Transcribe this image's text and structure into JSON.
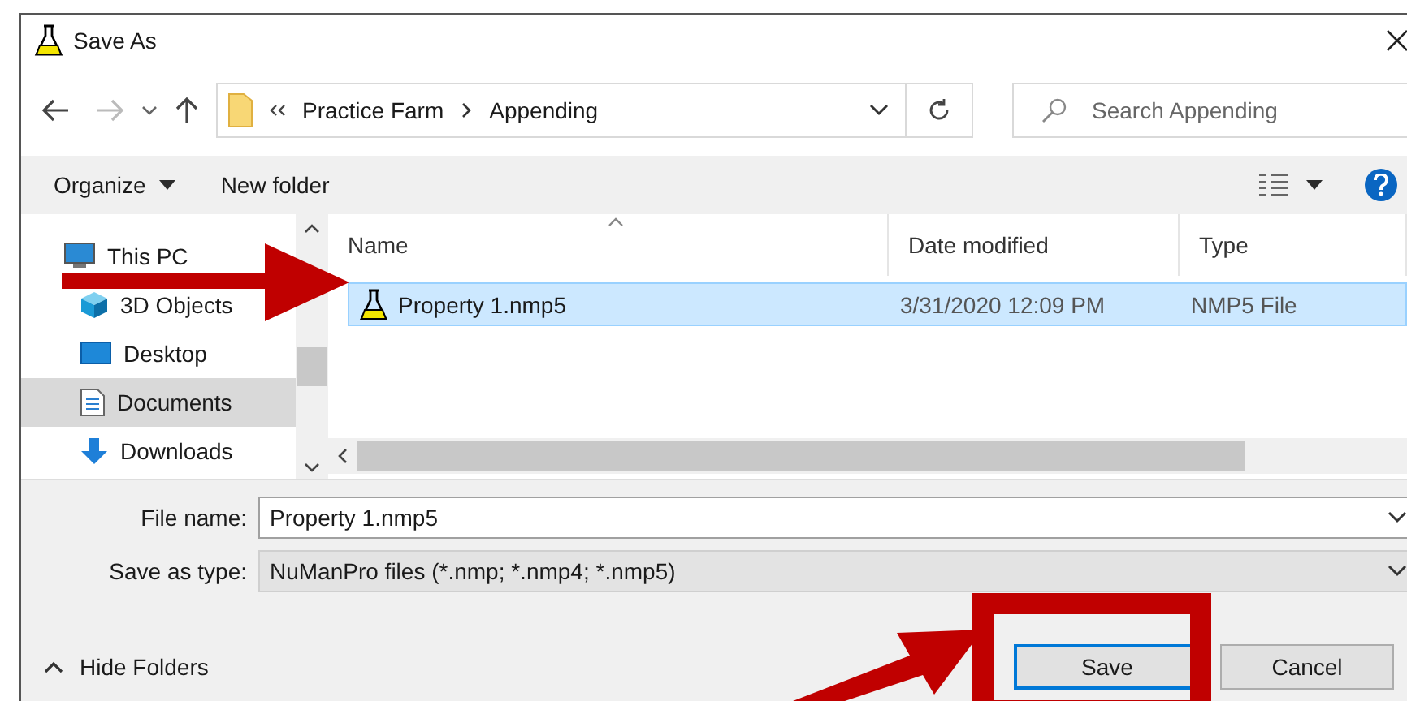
{
  "window": {
    "title": "Save As"
  },
  "address_bar": {
    "breadcrumbs": [
      "Practice Farm",
      "Appending"
    ]
  },
  "search": {
    "placeholder": "Search Appending"
  },
  "toolbar": {
    "buttons": [
      "Organize",
      "New folder"
    ]
  },
  "nav_pane": {
    "items": [
      {
        "label": "This PC",
        "kind": "pc",
        "selected": false,
        "children": [
          {
            "label": "3D Objects",
            "kind": "cube",
            "selected": false
          },
          {
            "label": "Desktop",
            "kind": "desktop",
            "selected": false
          },
          {
            "label": "Documents",
            "kind": "document",
            "selected": true
          },
          {
            "label": "Downloads",
            "kind": "download",
            "selected": false
          }
        ]
      }
    ]
  },
  "file_list": {
    "columns": [
      "Name",
      "Date modified",
      "Type"
    ],
    "rows": [
      {
        "name": "Property 1.nmp5",
        "date_modified": "3/31/2020 12:09 PM",
        "type": "NMP5 File",
        "selected": true
      }
    ]
  },
  "form": {
    "file_name": {
      "label": "File name:",
      "value": "Property 1.nmp5"
    },
    "save_as_type": {
      "label": "Save as type:",
      "value": "NuManPro files (*.nmp; *.nmp4; *.nmp5)"
    }
  },
  "footer": {
    "hide_folders": "Hide Folders",
    "buttons": [
      {
        "label": "Save",
        "kind": "default"
      },
      {
        "label": "Cancel",
        "kind": "normal"
      }
    ]
  }
}
